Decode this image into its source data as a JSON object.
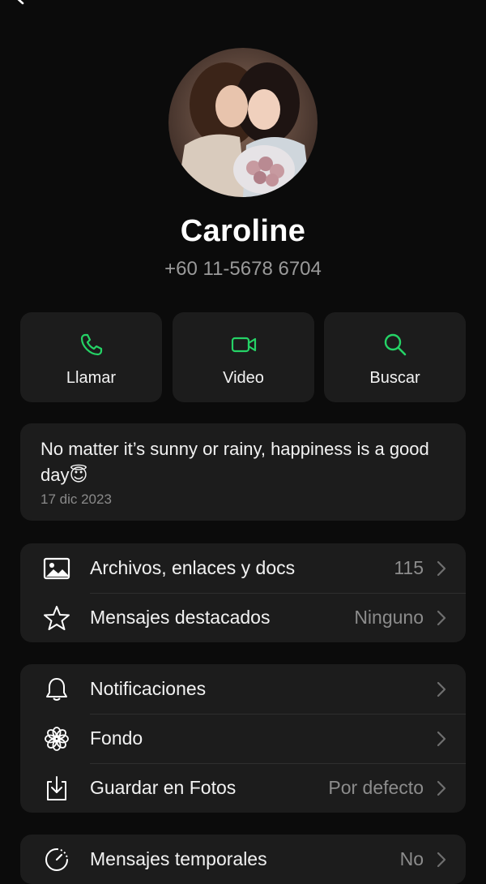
{
  "contact": {
    "name": "Caroline",
    "phone": "+60 11-5678 6704"
  },
  "actions": [
    {
      "label": "Llamar",
      "icon": "phone-icon"
    },
    {
      "label": "Video",
      "icon": "video-camera-icon"
    },
    {
      "label": "Buscar",
      "icon": "search-icon"
    }
  ],
  "about": {
    "text": "No matter it’s sunny or rainy, happiness is a good day😇",
    "date": "17 dic 2023"
  },
  "media_section": [
    {
      "label": "Archivos, enlaces y docs",
      "value": "115",
      "icon": "image-icon"
    },
    {
      "label": "Mensajes destacados",
      "value": "Ninguno",
      "icon": "star-icon"
    }
  ],
  "settings_section": [
    {
      "label": "Notificaciones",
      "value": "",
      "icon": "bell-icon"
    },
    {
      "label": "Fondo",
      "value": "",
      "icon": "wallpaper-flower-icon"
    },
    {
      "label": "Guardar en Fotos",
      "value": "Por defecto",
      "icon": "save-download-icon"
    }
  ],
  "privacy_section": [
    {
      "label": "Mensajes temporales",
      "value": "No",
      "icon": "timer-icon"
    }
  ],
  "colors": {
    "accent": "#25d366",
    "background": "#0b0b0b",
    "card": "#1c1c1c",
    "secondary_text": "#8c8c8c"
  }
}
